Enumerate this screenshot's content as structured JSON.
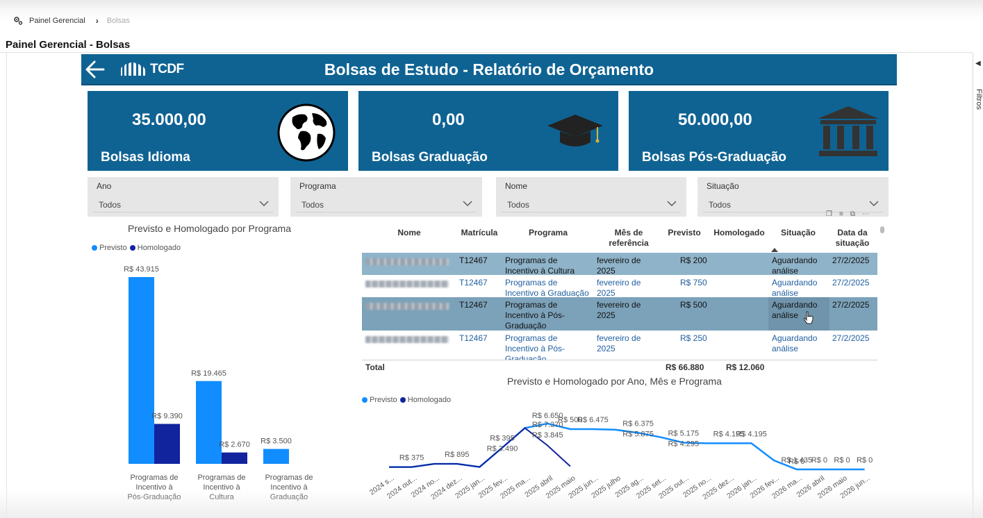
{
  "breadcrumb": {
    "root": "Painel Gerencial",
    "current": "Bolsas"
  },
  "page_title": "Painel Gerencial - Bolsas",
  "filters_tab": "Filtros",
  "banner": {
    "logo_text": "TCDF",
    "title": "Bolsas de Estudo - Relatório de Orçamento"
  },
  "kpis": [
    {
      "value": "35.000,00",
      "label": "Bolsas Idioma",
      "icon": "globe-icon"
    },
    {
      "value": "0,00",
      "label": "Bolsas Graduação",
      "icon": "graduation-cap-icon"
    },
    {
      "value": "50.000,00",
      "label": "Bolsas Pós-Graduação",
      "icon": "institution-building-icon"
    }
  ],
  "slicers": [
    {
      "label": "Ano",
      "value": "Todos"
    },
    {
      "label": "Programa",
      "value": "Todos"
    },
    {
      "label": "Nome",
      "value": "Todos"
    },
    {
      "label": "Situação",
      "value": "Todos"
    }
  ],
  "colors": {
    "previsto": "#118dff",
    "homologado": "#12239e",
    "banner": "#0f6393",
    "row_selected": "#8fb3c9",
    "row_highlight": "#7ca2ba",
    "link": "#1f5fa0"
  },
  "bar_chart": {
    "title": "Previsto e Homologado por Programa",
    "legend": [
      "Previsto",
      "Homologado"
    ]
  },
  "table": {
    "columns": [
      "Nome",
      "Matrícula",
      "Programa",
      "Mês de referência",
      "Previsto",
      "Homologado",
      "Situação",
      "Data da situação"
    ],
    "rows": [
      {
        "matricula": "T12467",
        "programa": "Programas de Incentivo à Cultura",
        "mes": "fevereiro de 2025",
        "previsto": "R$ 200",
        "homologado": "",
        "situacao": "Aguardando análise",
        "data": "27/2/2025",
        "state": "selected"
      },
      {
        "matricula": "T12467",
        "programa": "Programas de Incentivo à Graduação",
        "mes": "fevereiro de 2025",
        "previsto": "R$ 750",
        "homologado": "",
        "situacao": "Aguardando análise",
        "data": "27/2/2025",
        "state": "normal"
      },
      {
        "matricula": "T12467",
        "programa": "Programas de Incentivo à Pós-Graduação",
        "mes": "fevereiro de 2025",
        "previsto": "R$ 500",
        "homologado": "",
        "situacao": "Aguardando análise",
        "data": "27/2/2025",
        "state": "highlight"
      },
      {
        "matricula": "T12467",
        "programa": "Programas de Incentivo à Pós-Graduação",
        "mes": "fevereiro de 2025",
        "previsto": "R$ 250",
        "homologado": "",
        "situacao": "Aguardando análise",
        "data": "27/2/2025",
        "state": "normal"
      }
    ],
    "totals": {
      "label": "Total",
      "previsto": "R$ 66.880",
      "homologado": "R$ 12.060"
    }
  },
  "line_chart": {
    "title": "Previsto e Homologado por Ano, Mês e Programa",
    "legend": [
      "Previsto",
      "Homologado"
    ]
  },
  "chart_data": [
    {
      "type": "bar",
      "title": "Previsto e Homologado por Programa",
      "categories": [
        "Programas de Incentivo à Pós-Graduação",
        "Programas de Incentivo à Cultura",
        "Programas de Incentivo à Graduação"
      ],
      "series": [
        {
          "name": "Previsto",
          "values": [
            43915,
            19465,
            3500
          ],
          "labels": [
            "R$ 43.915",
            "R$ 19.465",
            "R$ 3.500"
          ]
        },
        {
          "name": "Homologado",
          "values": [
            9390,
            2670,
            null
          ],
          "labels": [
            "R$ 9.390",
            "R$ 2.670",
            ""
          ]
        }
      ],
      "legend": "top-left"
    },
    {
      "type": "line",
      "title": "Previsto e Homologado por Ano, Mês e Programa",
      "x": [
        "2024 s...",
        "2024 out...",
        "2024 no...",
        "2024 dez...",
        "2025 jan...",
        "2025 fev...",
        "2025 ma...",
        "2025 abril",
        "2025 maio",
        "2025 jun...",
        "2025 julho",
        "2025 ag...",
        "2025 set...",
        "2025 out...",
        "2025 no...",
        "2025 dez...",
        "2026 jan...",
        "2026 fev...",
        "2026 ma...",
        "2026 abril",
        "2026 maio",
        "2026 jun..."
      ],
      "series": [
        {
          "name": "Previsto",
          "values": [
            375,
            375,
            895,
            895,
            395,
            3490,
            6650,
            7370,
            6475,
            6475,
            6375,
            5875,
            5175,
            4295,
            4195,
            4195,
            4195,
            1435,
            0,
            0,
            0,
            0
          ]
        },
        {
          "name": "Homologado",
          "values": [
            375,
            375,
            895,
            895,
            395,
            3490,
            6650,
            3845,
            500,
            null,
            null,
            null,
            null,
            null,
            null,
            null,
            null,
            null,
            null,
            null,
            null,
            null
          ]
        }
      ],
      "point_labels": [
        {
          "i": 1,
          "text": "R$ 375"
        },
        {
          "i": 3,
          "text": "R$ 895"
        },
        {
          "i": 5,
          "text": "R$ 395"
        },
        {
          "i": 5,
          "text": "R$ 3.490"
        },
        {
          "i": 7,
          "text": "R$ 6.650"
        },
        {
          "i": 7,
          "text": "R$ 7.370"
        },
        {
          "i": 7,
          "text": "R$ 3.845"
        },
        {
          "i": 8,
          "text": "R$ 500"
        },
        {
          "i": 9,
          "text": "R$ 6.475"
        },
        {
          "i": 11,
          "text": "R$ 6.375"
        },
        {
          "i": 11,
          "text": "R$ 5.875"
        },
        {
          "i": 13,
          "text": "R$ 5.175"
        },
        {
          "i": 13,
          "text": "R$ 4.295"
        },
        {
          "i": 15,
          "text": "R$ 4.195"
        },
        {
          "i": 16,
          "text": "R$ 4.195"
        },
        {
          "i": 18,
          "text": "R$ 1.435"
        },
        {
          "i": 18,
          "text": "R$ 0"
        },
        {
          "i": 19,
          "text": "R$ 0"
        },
        {
          "i": 20,
          "text": "R$ 0"
        },
        {
          "i": 21,
          "text": "R$ 0"
        }
      ],
      "legend": "top-left"
    }
  ]
}
